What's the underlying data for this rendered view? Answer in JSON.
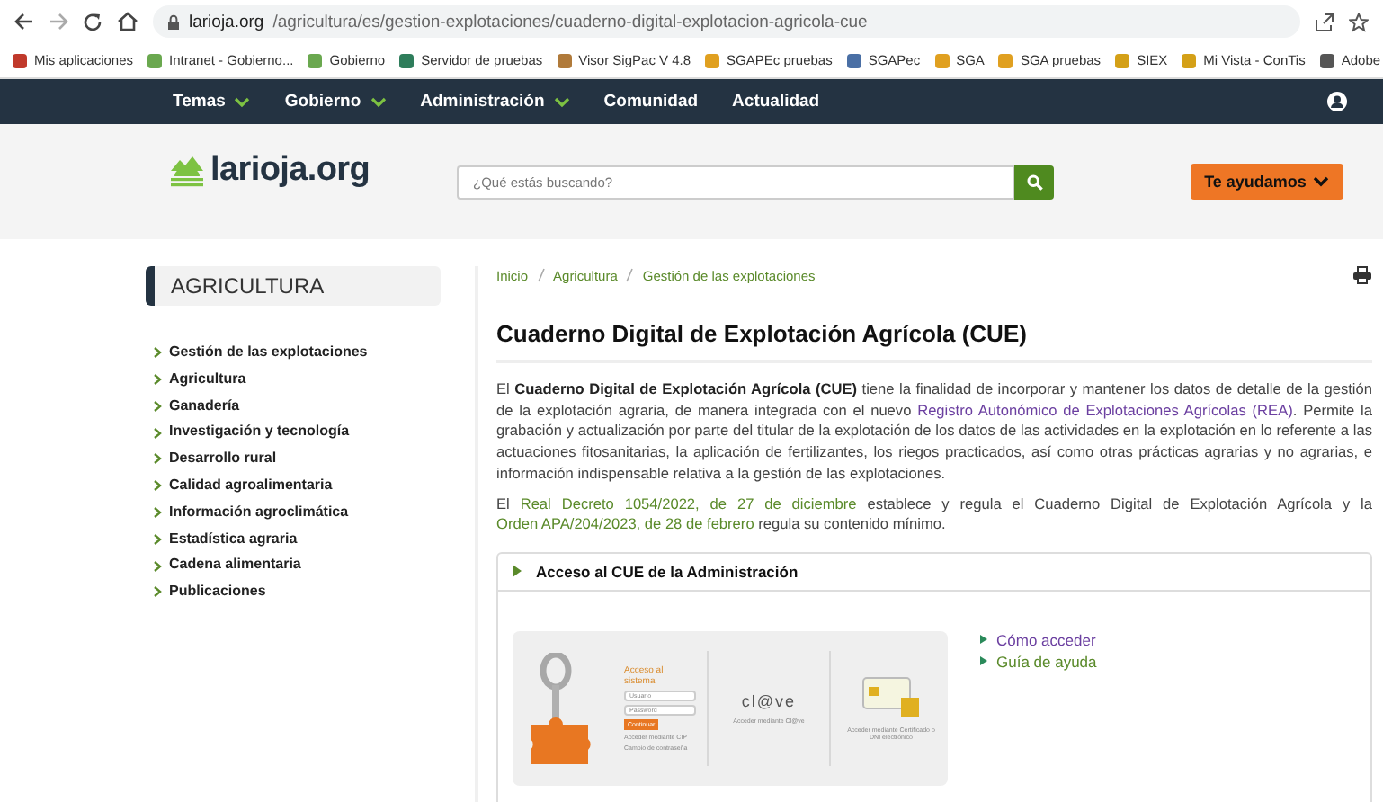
{
  "browser": {
    "url_host": "larioja.org",
    "url_path": "/agricultura/es/gestion-explotaciones/cuaderno-digital-explotacion-agricola-cue",
    "bookmarks": [
      {
        "label": "Mis aplicaciones",
        "color": "#c0392b"
      },
      {
        "label": "Intranet - Gobierno...",
        "color": "#6aa84f"
      },
      {
        "label": "Gobierno",
        "color": "#6aa84f"
      },
      {
        "label": "Servidor de pruebas",
        "color": "#2e7d5b"
      },
      {
        "label": "Visor SigPac V 4.8",
        "color": "#b07a3a"
      },
      {
        "label": "SGAPEc pruebas",
        "color": "#e0a020"
      },
      {
        "label": "SGAPec",
        "color": "#4a6fa5"
      },
      {
        "label": "SGA",
        "color": "#e0a020"
      },
      {
        "label": "SGA pruebas",
        "color": "#e0a020"
      },
      {
        "label": "SIEX",
        "color": "#d4a017"
      },
      {
        "label": "Mi Vista - ConTis",
        "color": "#d4a017"
      },
      {
        "label": "Adobe",
        "color": "#555555"
      }
    ]
  },
  "nav": {
    "items": [
      {
        "label": "Temas",
        "dropdown": true
      },
      {
        "label": "Gobierno",
        "dropdown": true
      },
      {
        "label": "Administración",
        "dropdown": true
      },
      {
        "label": "Comunidad",
        "dropdown": false
      },
      {
        "label": "Actualidad",
        "dropdown": false
      }
    ]
  },
  "header": {
    "logo": "larioja.org",
    "search": {
      "placeholder": "¿Qué estás buscando?"
    },
    "help_button": "Te ayudamos"
  },
  "sidebar": {
    "title": "AGRICULTURA",
    "items": [
      "Gestión de las explotaciones",
      "Agricultura",
      "Ganadería",
      "Investigación y tecnología",
      "Desarrollo rural",
      "Calidad agroalimentaria",
      "Información agroclimática",
      "Estadística agraria",
      "Cadena alimentaria",
      "Publicaciones"
    ]
  },
  "breadcrumb": [
    "Inicio",
    "Agricultura",
    "Gestión de las explotaciones"
  ],
  "title": "Cuaderno Digital de Explotación Agrícola (CUE)",
  "paragraphs": [
    [
      {
        "kind": "text",
        "text": "El "
      },
      {
        "kind": "bold",
        "text": "Cuaderno Digital de Explotación Agrícola (CUE)"
      },
      {
        "kind": "text",
        "text": " tiene la finalidad de incorporar y mantener los datos de detalle de la gestión de la explotación agraria, de manera integrada con el nuevo "
      },
      {
        "kind": "visited_link",
        "text": "Registro Autonómico de Explotaciones Agrícolas (REA)"
      },
      {
        "kind": "text",
        "text": ". Permite la grabación y actualización por parte del titular de la explotación de los datos de las actividades en la explotación en lo referente a las actuaciones fitosanitarias, la aplicación de fertilizantes, los riegos practicados, así como otras prácticas agrarias y no agrarias, e información indispensable relativa a la gestión de las explotaciones."
      }
    ],
    [
      {
        "kind": "text",
        "text": "El "
      },
      {
        "kind": "link",
        "text": "Real Decreto 1054/2022, de 27 de diciembre"
      },
      {
        "kind": "text",
        "text": " establece y regula el Cuaderno Digital de Explotación Agrícola y la "
      },
      {
        "kind": "link",
        "text": "Orden APA/204/2023, de 28 de febrero"
      },
      {
        "kind": "text",
        "text": " regula su contenido mínimo."
      }
    ]
  ],
  "accordion": {
    "title": "Acceso al CUE de la Administración",
    "expanded": true,
    "login_screenshot": {
      "heading": "Acceso al sistema",
      "user_placeholder": "Usuario",
      "password_placeholder": "Password",
      "button": "Continuar",
      "links": [
        "Acceder mediante CIP",
        "Cambio de contraseña"
      ],
      "clave_logo": "cl@ve",
      "clave_caption": "Acceder mediante Cl@ve",
      "cert_caption": "Acceder mediante Certificado o DNI electrónico"
    },
    "links": [
      {
        "label": "Cómo acceder",
        "visited": true
      },
      {
        "label": "Guía de ayuda",
        "visited": false
      }
    ]
  }
}
